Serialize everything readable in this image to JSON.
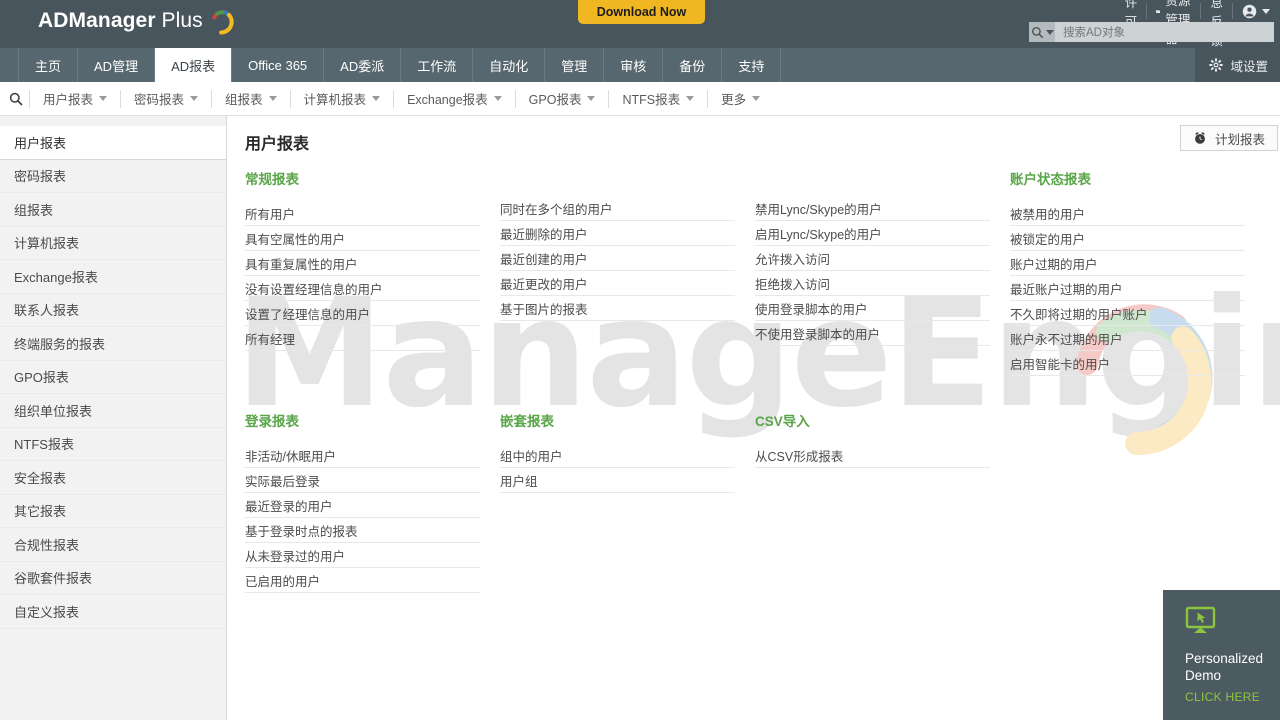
{
  "header": {
    "product_name_bold": "ADManager",
    "product_name_light": " Plus",
    "download_label": "Download Now",
    "right_items": [
      {
        "label": "许可",
        "icon": ""
      },
      {
        "label": "AD资源管理器",
        "icon": "folder-icon"
      },
      {
        "label": "信息反馈",
        "icon": ""
      },
      {
        "label": "",
        "icon": "user-account-icon"
      }
    ],
    "search_placeholder": "搜索AD对象",
    "search_value": "",
    "search_icon": "magnifier-icon",
    "domain_settings_label": "域设置",
    "domain_settings_icon": "gear-icon",
    "colors": {
      "topbar": "#49555c",
      "tabbar": "#57676f",
      "accent": "#f0b722",
      "green": "#5aa54a"
    }
  },
  "tabs": [
    {
      "label": "主页",
      "active": false
    },
    {
      "label": "AD管理",
      "active": false
    },
    {
      "label": "AD报表",
      "active": true
    },
    {
      "label": "Office 365",
      "active": false
    },
    {
      "label": "AD委派",
      "active": false
    },
    {
      "label": "工作流",
      "active": false
    },
    {
      "label": "自动化",
      "active": false
    },
    {
      "label": "管理",
      "active": false
    },
    {
      "label": "审核",
      "active": false
    },
    {
      "label": "备份",
      "active": false
    },
    {
      "label": "支持",
      "active": false
    }
  ],
  "subnav": {
    "search_icon": "magnifier-icon",
    "items": [
      {
        "label": "用户报表"
      },
      {
        "label": "密码报表"
      },
      {
        "label": "组报表"
      },
      {
        "label": "计算机报表"
      },
      {
        "label": "Exchange报表"
      },
      {
        "label": "GPO报表"
      },
      {
        "label": "NTFS报表"
      },
      {
        "label": "更多"
      }
    ]
  },
  "sidebar": {
    "items": [
      {
        "label": "用户报表",
        "active": true
      },
      {
        "label": "密码报表",
        "active": false
      },
      {
        "label": "组报表",
        "active": false
      },
      {
        "label": "计算机报表",
        "active": false
      },
      {
        "label": "Exchange报表",
        "active": false
      },
      {
        "label": "联系人报表",
        "active": false
      },
      {
        "label": "终端服务的报表",
        "active": false
      },
      {
        "label": "GPO报表",
        "active": false
      },
      {
        "label": "组织单位报表",
        "active": false
      },
      {
        "label": "NTFS报表",
        "active": false
      },
      {
        "label": "安全报表",
        "active": false
      },
      {
        "label": "其它报表",
        "active": false
      },
      {
        "label": "合规性报表",
        "active": false
      },
      {
        "label": "谷歌套件报表",
        "active": false
      },
      {
        "label": "自定义报表",
        "active": false
      }
    ]
  },
  "main": {
    "page_title": "用户报表",
    "schedule_button": {
      "label": "计划报表",
      "icon": "alarm-clock-icon"
    },
    "watermark": "ManageEngine",
    "sections": [
      {
        "title": "常规报表",
        "row": 1,
        "links": [
          "所有用户",
          "具有空属性的用户",
          "具有重复属性的用户",
          "没有设置经理信息的用户",
          "设置了经理信息的用户",
          "所有经理"
        ]
      },
      {
        "title": "",
        "row": 1,
        "links": [
          "同时在多个组的用户",
          "最近删除的用户",
          "最近创建的用户",
          "最近更改的用户",
          "基于图片的报表"
        ]
      },
      {
        "title": "",
        "row": 1,
        "links": [
          "禁用Lync/Skype的用户",
          "启用Lync/Skype的用户",
          "允许拨入访问",
          "拒绝拨入访问",
          "使用登录脚本的用户",
          "不使用登录脚本的用户"
        ]
      },
      {
        "title": "账户状态报表",
        "row": 1,
        "links": [
          "被禁用的用户",
          "被锁定的用户",
          "账户过期的用户",
          "最近账户过期的用户",
          "不久即将过期的用户账户",
          "账户永不过期的用户",
          "启用智能卡的用户"
        ]
      },
      {
        "title": "登录报表",
        "row": 2,
        "links": [
          "非活动/休眠用户",
          "实际最后登录",
          "最近登录的用户",
          "基于登录时点的报表",
          "从未登录过的用户",
          "已启用的用户"
        ]
      },
      {
        "title": "嵌套报表",
        "row": 2,
        "links": [
          "组中的用户",
          "用户组"
        ]
      },
      {
        "title": "CSV导入",
        "row": 2,
        "links": [
          "从CSV形成报表"
        ]
      },
      {
        "title": "",
        "row": 2,
        "links": []
      }
    ]
  },
  "demo_widget": {
    "icon": "monitor-cursor-icon",
    "title": "Personalized Demo",
    "cta": "CLICK HERE"
  }
}
